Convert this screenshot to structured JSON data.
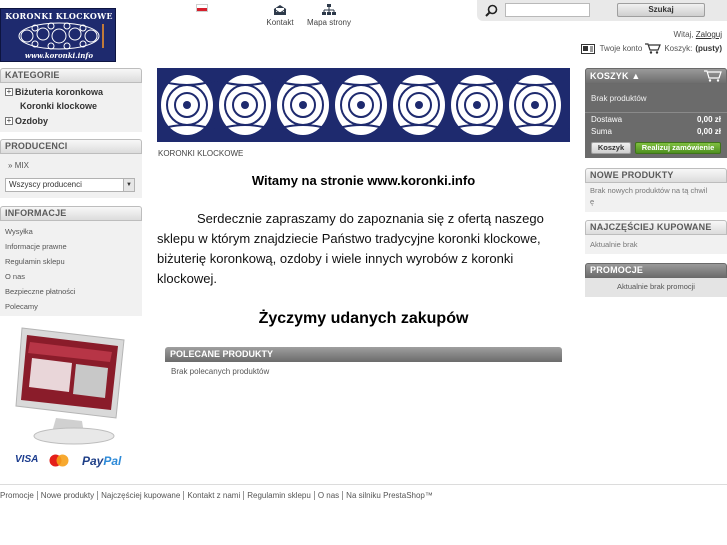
{
  "header": {
    "logo_title": "KORONKI KLOCKOWE",
    "logo_url": "www.koronki.info",
    "contact_label": "Kontakt",
    "sitemap_label": "Mapa strony",
    "search_placeholder": "",
    "search_button": "Szukaj",
    "welcome_text": "Witaj,",
    "login_link": "Zaloguj",
    "account_label": "Twoje konto",
    "cart_label": "Koszyk:",
    "cart_status": "(pusty)"
  },
  "categories": {
    "title": "KATEGORIE",
    "items": [
      {
        "label": "Biżuteria koronkowa",
        "expandable": true
      },
      {
        "label": "Koronki klockowe",
        "expandable": false
      },
      {
        "label": "Ozdoby",
        "expandable": true
      }
    ]
  },
  "manufacturers": {
    "title": "PRODUCENCI",
    "items": [
      "MIX"
    ],
    "select_value": "Wszyscy producenci"
  },
  "information": {
    "title": "INFORMACJE",
    "items": [
      "Wysyłka",
      "Informacje prawne",
      "Regulamin sklepu",
      "O nas",
      "Bezpieczne płatności",
      "Polecamy"
    ]
  },
  "payments": {
    "visa": "VISA",
    "paypal_a": "Pay",
    "paypal_b": "Pal"
  },
  "main": {
    "breadcrumb": "KORONKI KLOCKOWE",
    "heading": "Witamy na stronie www.koronki.info",
    "intro": "Serdecznie zapraszamy do zapoznania się z ofertą naszego sklepu w którym znajdziecie Państwo tradycyjne koronki klockowe, biżuterię koronkową, ozdoby i wiele innych wyrobów z koronki klockowej.",
    "wish": "Życzymy udanych zakupów",
    "featured_title": "POLECANE PRODUKTY",
    "featured_empty": "Brak polecanych produktów"
  },
  "cart": {
    "title": "KOSZYK",
    "empty": "Brak produktów",
    "shipping_label": "Dostawa",
    "shipping_value": "0,00 zł",
    "total_label": "Suma",
    "total_value": "0,00 zł",
    "cart_button": "Koszyk",
    "order_button": "Realizuj zamówienie"
  },
  "new_products": {
    "title": "NOWE PRODUKTY",
    "text_a": "Brak nowych produktów na tą chwil",
    "text_b": "ę"
  },
  "best_sellers": {
    "title": "NAJCZĘŚCIEJ KUPOWANE",
    "text": "Aktualnie brak"
  },
  "promotions": {
    "title": "PROMOCJE",
    "text": "Aktualnie brak promocji"
  },
  "footer": {
    "links": [
      "Promocje",
      "Nowe produkty",
      "Najczęściej kupowane",
      "Kontakt z nami",
      "Regulamin sklepu",
      "O nas",
      "Na silniku PrestaShop™"
    ]
  },
  "colors": {
    "brand_navy": "#1e2a6e",
    "order_green": "#5a9a28",
    "flag_red": "#d61f2c"
  }
}
